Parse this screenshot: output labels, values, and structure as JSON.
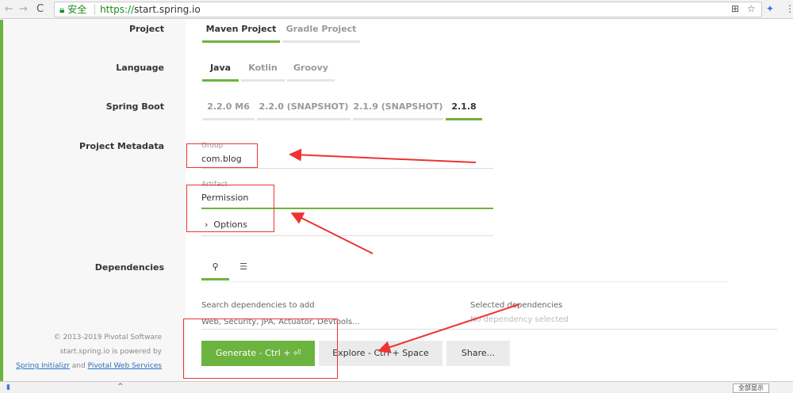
{
  "browser": {
    "secure_label": "安全",
    "url_scheme": "https://",
    "url_host": "start.spring.io",
    "show_all": "全部显示"
  },
  "project": {
    "label": "Project",
    "options": [
      "Maven Project",
      "Gradle Project"
    ],
    "selected": "Maven Project"
  },
  "language": {
    "label": "Language",
    "options": [
      "Java",
      "Kotlin",
      "Groovy"
    ],
    "selected": "Java"
  },
  "spring_boot": {
    "label": "Spring Boot",
    "options": [
      "2.2.0 M6",
      "2.2.0 (SNAPSHOT)",
      "2.1.9 (SNAPSHOT)",
      "2.1.8"
    ],
    "selected": "2.1.8"
  },
  "metadata": {
    "label": "Project Metadata",
    "group_label": "Group",
    "group_value": "com.blog",
    "artifact_label": "Artifact",
    "artifact_value": "Permission",
    "options_label": "Options"
  },
  "dependencies": {
    "label": "Dependencies",
    "search_label": "Search dependencies to add",
    "search_placeholder": "Web, Security, JPA, Actuator, Devtools...",
    "selected_label": "Selected dependencies",
    "none_selected": "No dependency selected"
  },
  "actions": {
    "generate": "Generate - Ctrl + ⏎",
    "explore": "Explore - Ctrl + Space",
    "share": "Share..."
  },
  "footer": {
    "copyright": "© 2013-2019 Pivotal Software",
    "powered": "start.spring.io is powered by",
    "link1": "Spring Initializr",
    "and": "and",
    "link2": "Pivotal Web Services"
  },
  "colors": {
    "accent": "#6db33f",
    "annotation": "#e33333"
  }
}
